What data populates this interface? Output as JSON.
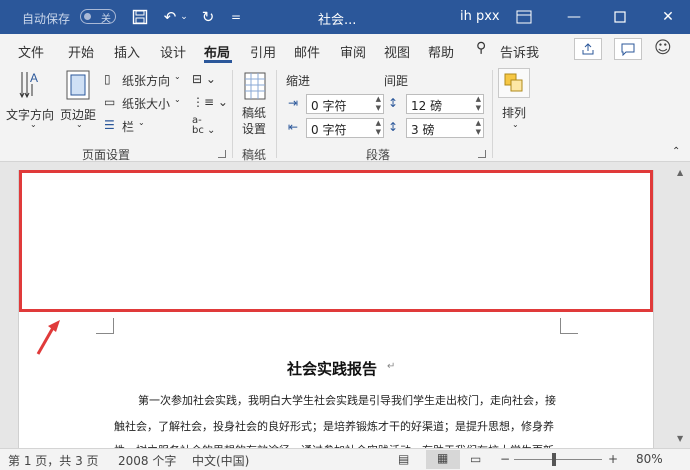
{
  "titlebar": {
    "autosave": "自动保存",
    "toggle": "关",
    "title": "社会...",
    "user": "ih pxx",
    "qat_more": "="
  },
  "menu": {
    "tabs": [
      "文件",
      "开始",
      "插入",
      "设计",
      "布局",
      "引用",
      "邮件",
      "审阅",
      "视图",
      "帮助",
      "告诉我"
    ],
    "active": "布局"
  },
  "ribbon": {
    "text_direction": "文字方向",
    "margins": "页边距",
    "orientation": "纸张方向",
    "size": "纸张大小",
    "columns": "栏",
    "page_setup_group": "页面设置",
    "draft_btn_1": "稿纸",
    "draft_btn_2": "设置",
    "draft_group": "稿纸",
    "indent_label": "缩进",
    "spacing_label": "间距",
    "indent_left": "0 字符",
    "indent_right": "0 字符",
    "spacing_before": "12 磅",
    "spacing_after": "3 磅",
    "paragraph_group": "段落",
    "arrange": "排列"
  },
  "document": {
    "title": "社会实践报告",
    "line1": "第一次参加社会实践，我明白大学生社会实践是引导我们学生走出校门，走向社会，接",
    "line2": "触社会，了解社会，投身社会的良好形式；是培养锻炼才干的好渠道；是提升思想，修身养",
    "line3": "性，树立服务社会的思想的有效途径。通过参加社会实践活动，有助于我们在校大学生更新"
  },
  "status": {
    "page": "第 1 页，共 3 页",
    "words": "2008 个字",
    "language": "中文(中国)",
    "zoom": "80%"
  },
  "colors": {
    "titlebar": "#2b579a",
    "highlight": "#e03a3a"
  }
}
